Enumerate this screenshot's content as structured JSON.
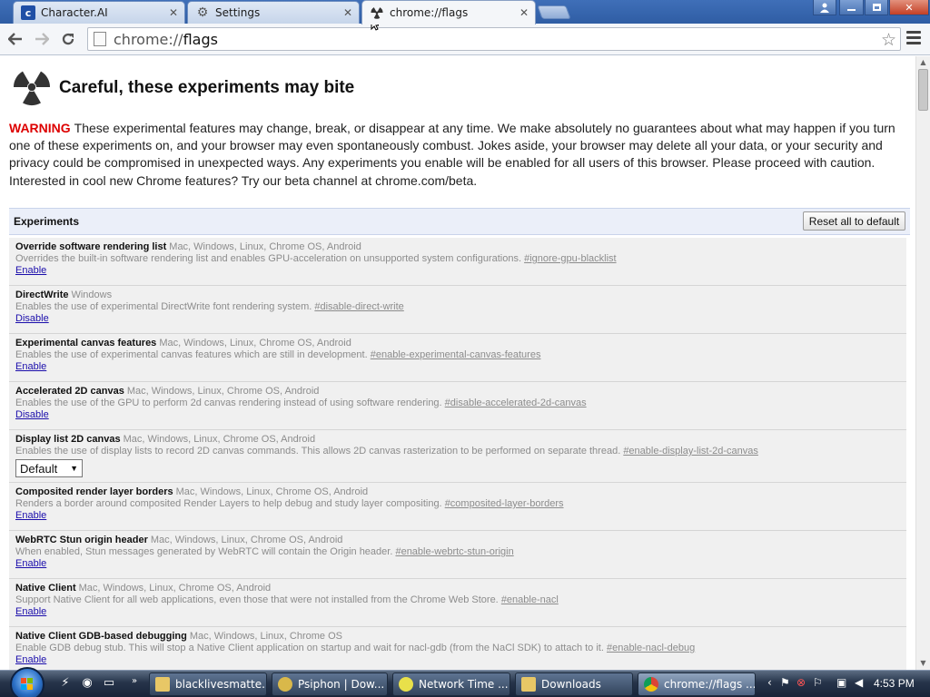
{
  "tabs": [
    {
      "label": "Character.AI",
      "icon": "character-ai-icon"
    },
    {
      "label": "Settings",
      "icon": "gear-icon"
    },
    {
      "label": "chrome://flags",
      "icon": "radiation-icon",
      "active": true
    }
  ],
  "toolbar": {
    "url_scheme": "chrome://",
    "url_path": "flags"
  },
  "page": {
    "title": "Careful, these experiments may bite",
    "warning_label": "WARNING",
    "warning_text": "These experimental features may change, break, or disappear at any time. We make absolutely no guarantees about what may happen if you turn one of these experiments on, and your browser may even spontaneously combust. Jokes aside, your browser may delete all your data, or your security and privacy could be compromised in unexpected ways. Any experiments you enable will be enabled for all users of this browser. Please proceed with caution. Interested in cool new Chrome features? Try our beta channel at chrome.com/beta.",
    "experiments_heading": "Experiments",
    "reset_button": "Reset all to default"
  },
  "experiments": [
    {
      "name": "Override software rendering list",
      "platforms": "Mac, Windows, Linux, Chrome OS, Android",
      "desc": "Overrides the built-in software rendering list and enables GPU-acceleration on unsupported system configurations.",
      "anchor": "#ignore-gpu-blacklist",
      "action": "Enable"
    },
    {
      "name": "DirectWrite",
      "platforms": "Windows",
      "desc": "Enables the use of experimental DirectWrite font rendering system.",
      "anchor": "#disable-direct-write",
      "action": "Disable"
    },
    {
      "name": "Experimental canvas features",
      "platforms": "Mac, Windows, Linux, Chrome OS, Android",
      "desc": "Enables the use of experimental canvas features which are still in development.",
      "anchor": "#enable-experimental-canvas-features",
      "action": "Enable"
    },
    {
      "name": "Accelerated 2D canvas",
      "platforms": "Mac, Windows, Linux, Chrome OS, Android",
      "desc": "Enables the use of the GPU to perform 2d canvas rendering instead of using software rendering.",
      "anchor": "#disable-accelerated-2d-canvas",
      "action": "Disable"
    },
    {
      "name": "Display list 2D canvas",
      "platforms": "Mac, Windows, Linux, Chrome OS, Android",
      "desc": "Enables the use of display lists to record 2D canvas commands. This allows 2D canvas rasterization to be performed on separate thread.",
      "anchor": "#enable-display-list-2d-canvas",
      "select": "Default"
    },
    {
      "name": "Composited render layer borders",
      "platforms": "Mac, Windows, Linux, Chrome OS, Android",
      "desc": "Renders a border around composited Render Layers to help debug and study layer compositing.",
      "anchor": "#composited-layer-borders",
      "action": "Enable"
    },
    {
      "name": "WebRTC Stun origin header",
      "platforms": "Mac, Windows, Linux, Chrome OS, Android",
      "desc": "When enabled, Stun messages generated by WebRTC will contain the Origin header.",
      "anchor": "#enable-webrtc-stun-origin",
      "action": "Enable"
    },
    {
      "name": "Native Client",
      "platforms": "Mac, Windows, Linux, Chrome OS, Android",
      "desc": "Support Native Client for all web applications, even those that were not installed from the Chrome Web Store.",
      "anchor": "#enable-nacl",
      "action": "Enable"
    },
    {
      "name": "Native Client GDB-based debugging",
      "platforms": "Mac, Windows, Linux, Chrome OS",
      "desc": "Enable GDB debug stub. This will stop a Native Client application on startup and wait for nacl-gdb (from the NaCl SDK) to attach to it.",
      "anchor": "#enable-nacl-debug",
      "action": "Enable"
    }
  ],
  "taskbar": {
    "items": [
      {
        "label": "blacklivesmatte...",
        "icon": "folder-icon"
      },
      {
        "label": "Psiphon | Dow...",
        "icon": "psiphon-icon"
      },
      {
        "label": "Network Time ...",
        "icon": "clock-app-icon"
      },
      {
        "label": "Downloads",
        "icon": "folder-icon"
      },
      {
        "label": "chrome://flags ...",
        "icon": "chrome-icon",
        "active": true
      }
    ],
    "clock": "4:53 PM"
  }
}
